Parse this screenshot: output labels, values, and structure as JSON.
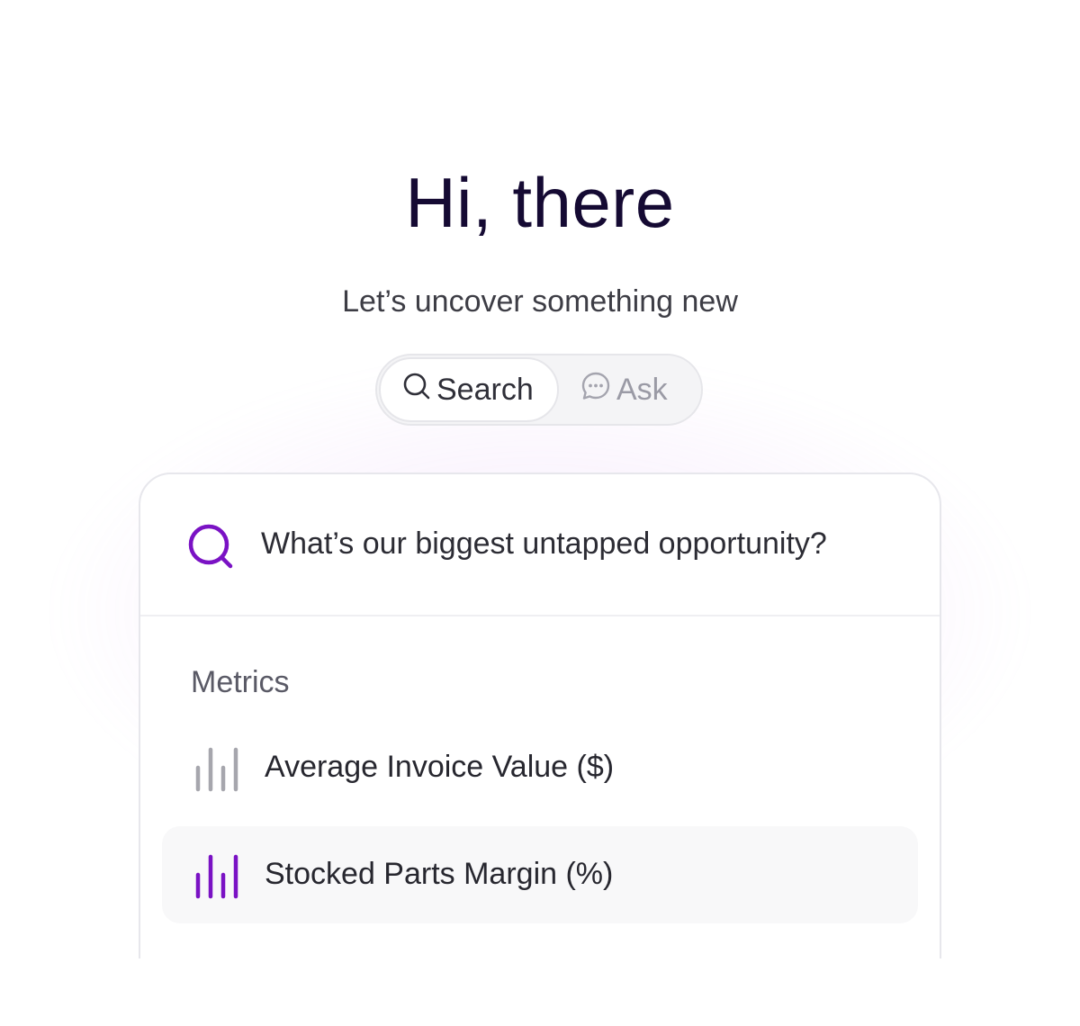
{
  "header": {
    "title": "Hi, there",
    "subtitle": "Let’s uncover something new"
  },
  "mode_toggle": {
    "search_label": "Search",
    "ask_label": "Ask",
    "selected": "Search"
  },
  "search": {
    "query": "What’s our biggest untapped opportunity?"
  },
  "results": {
    "section_label": "Metrics",
    "items": [
      {
        "label": "Average Invoice Value ($)",
        "icon": "bar-chart-icon",
        "color": "#a6a6ad",
        "highlighted": false
      },
      {
        "label": "Stocked Parts Margin (%)",
        "icon": "bar-chart-icon",
        "color": "#7a12c4",
        "highlighted": true
      }
    ]
  },
  "colors": {
    "accent": "#7a12c4",
    "title": "#150a33",
    "muted_icon": "#a6a6ad"
  }
}
